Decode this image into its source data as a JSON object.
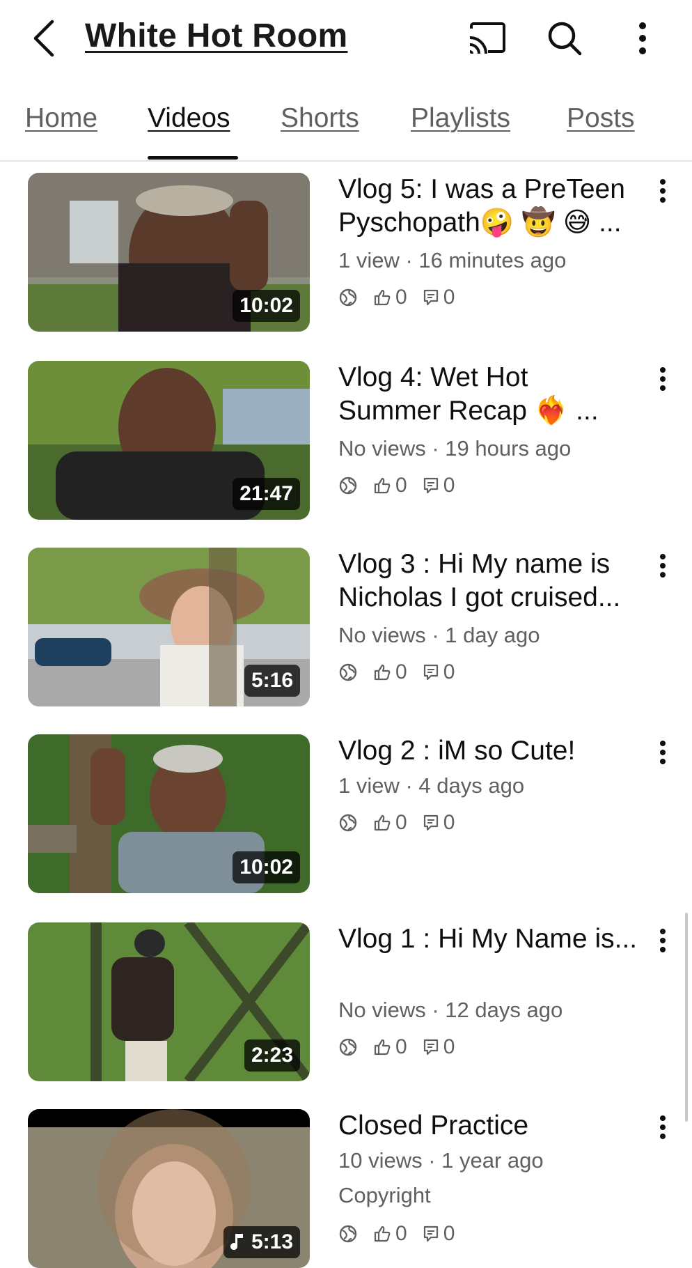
{
  "header": {
    "channel_title": "White Hot Room",
    "icons": [
      "back-arrow-icon",
      "cast-icon",
      "search-icon",
      "more-vert-icon"
    ]
  },
  "tabs": [
    {
      "label": "Home"
    },
    {
      "label": "Videos",
      "active": true
    },
    {
      "label": "Shorts"
    },
    {
      "label": "Playlists"
    },
    {
      "label": "Posts"
    }
  ],
  "videos": [
    {
      "title": "Vlog 5: I was a PreTeen Pyschopath🤪 🤠 😅 ...",
      "meta": "1 view · 16 minutes ago",
      "duration": "10:02",
      "likes": "0",
      "comments": "0"
    },
    {
      "title": "Vlog 4: Wet Hot Summer Recap ❤️‍🔥 ...",
      "meta": "No views · 19 hours ago",
      "duration": "21:47",
      "likes": "0",
      "comments": "0"
    },
    {
      "title": "Vlog 3 : Hi My name is Nicholas I got cruised...",
      "meta": "No views · 1 day ago",
      "duration": "5:16",
      "likes": "0",
      "comments": "0"
    },
    {
      "title": "Vlog 2 : iM so Cute!",
      "meta": "1 view · 4 days ago",
      "duration": "10:02",
      "likes": "0",
      "comments": "0"
    },
    {
      "title": "Vlog 1 : Hi My Name is...",
      "meta": "No views · 12 days ago",
      "duration": "2:23",
      "likes": "0",
      "comments": "0"
    },
    {
      "title": "Closed Practice",
      "meta": "10 views · 1 year ago",
      "extra": "Copyright",
      "duration": "5:13",
      "has_music_icon": true,
      "likes": "0",
      "comments": "0"
    }
  ],
  "colors": {
    "text_primary": "#0f0f0f",
    "text_secondary": "#606060",
    "divider": "#e5e5e5",
    "duration_bg": "#000000"
  }
}
